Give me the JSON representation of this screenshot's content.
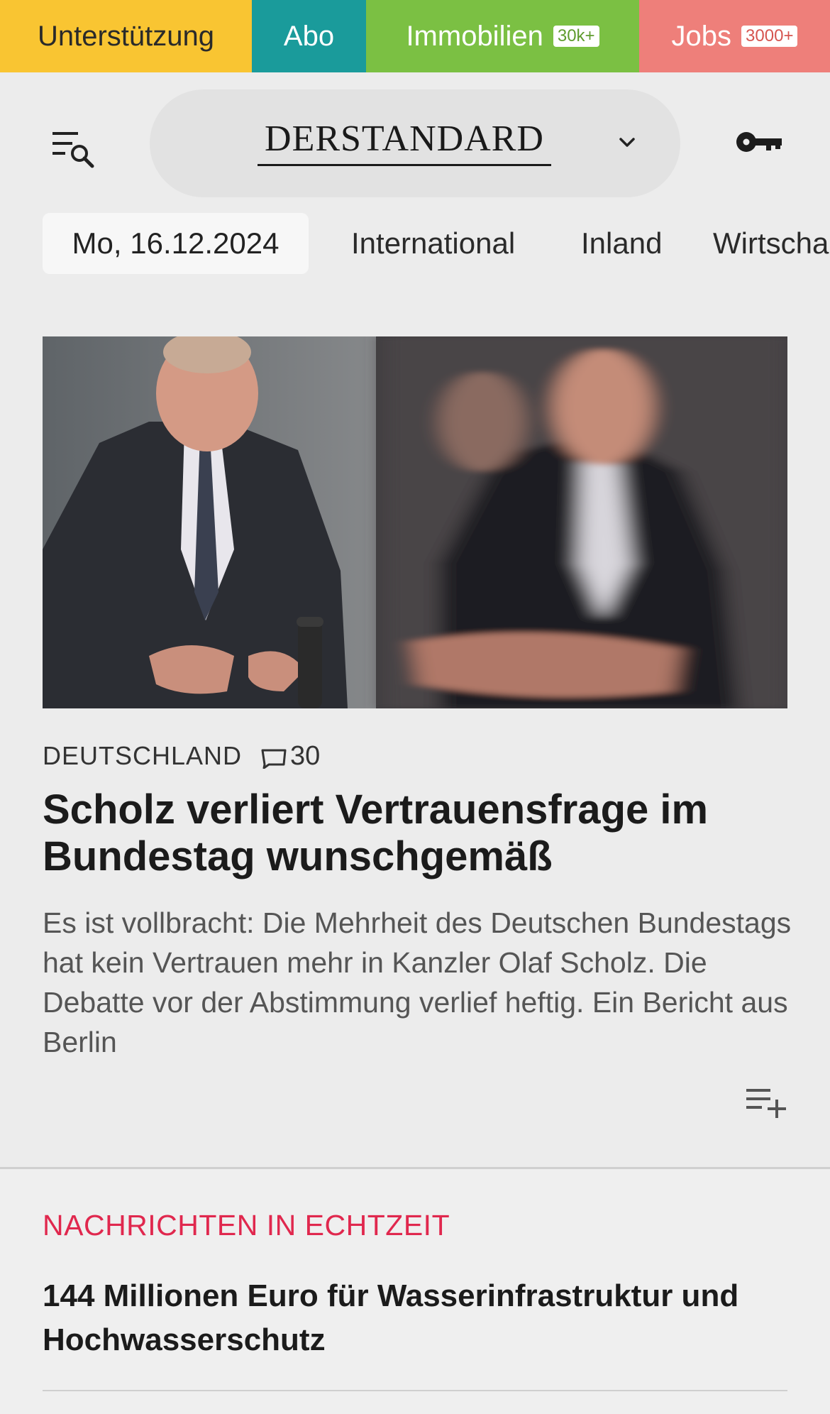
{
  "topbar": {
    "support": "Unterstützung",
    "abo": "Abo",
    "immobilien": "Immobilien",
    "immobilien_badge": "30k+",
    "jobs": "Jobs",
    "jobs_badge": "3000+"
  },
  "header": {
    "logo": "DERSTANDARD",
    "menu_icon": "menu-search-icon",
    "dropdown_icon": "chevron-down-icon",
    "login_icon": "key-icon"
  },
  "nav": {
    "date": "Mo, 16.12.2024",
    "items": [
      "International",
      "Inland",
      "Wirtscha"
    ]
  },
  "article": {
    "kicker": "DEUTSCHLAND",
    "comments": "30",
    "headline": "Scholz verliert Vertrauensfrage im Bundestag wunschgemäß",
    "teaser": "Es ist vollbracht: Die Mehrheit des Deutschen Bundestags hat kein Vertrauen mehr in Kanzler Olaf Scholz. Die Debatte vor der Abstimmung verlief heftig. Ein Bericht aus Berlin"
  },
  "live": {
    "title": "NACHRICHTEN IN ECHTZEIT",
    "headline": "144 Millionen Euro für Wasserinfrastruktur und Hochwasserschutz"
  },
  "colors": {
    "support": "#f9c532",
    "abo": "#1a9b9b",
    "immobilien": "#7bc043",
    "jobs": "#ee7f7a",
    "live_accent": "#e0284e"
  }
}
